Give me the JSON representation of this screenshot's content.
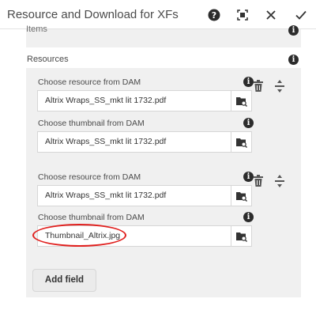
{
  "header": {
    "title": "Resource and Download for XFs",
    "icons": [
      "help-icon",
      "fullscreen-icon",
      "close-icon",
      "done-icon"
    ]
  },
  "items_section": {
    "label": "Items"
  },
  "resources": {
    "label": "Resources",
    "entries": [
      {
        "resource_label": "Choose resource from DAM",
        "resource_value": "Altrix Wraps_SS_mkt lit 1732.pdf",
        "thumbnail_label": "Choose thumbnail from DAM",
        "thumbnail_value": "Altrix Wraps_SS_mkt lit 1732.pdf"
      },
      {
        "resource_label": "Choose resource from DAM",
        "resource_value": "Altrix Wraps_SS_mkt lit 1732.pdf",
        "thumbnail_label": "Choose thumbnail from DAM",
        "thumbnail_value": "Thumbnail_Altrix.jpg"
      }
    ],
    "add_field_label": "Add field"
  },
  "colors": {
    "highlight": "#e0201e",
    "panel_bg": "#f0f0f0"
  }
}
